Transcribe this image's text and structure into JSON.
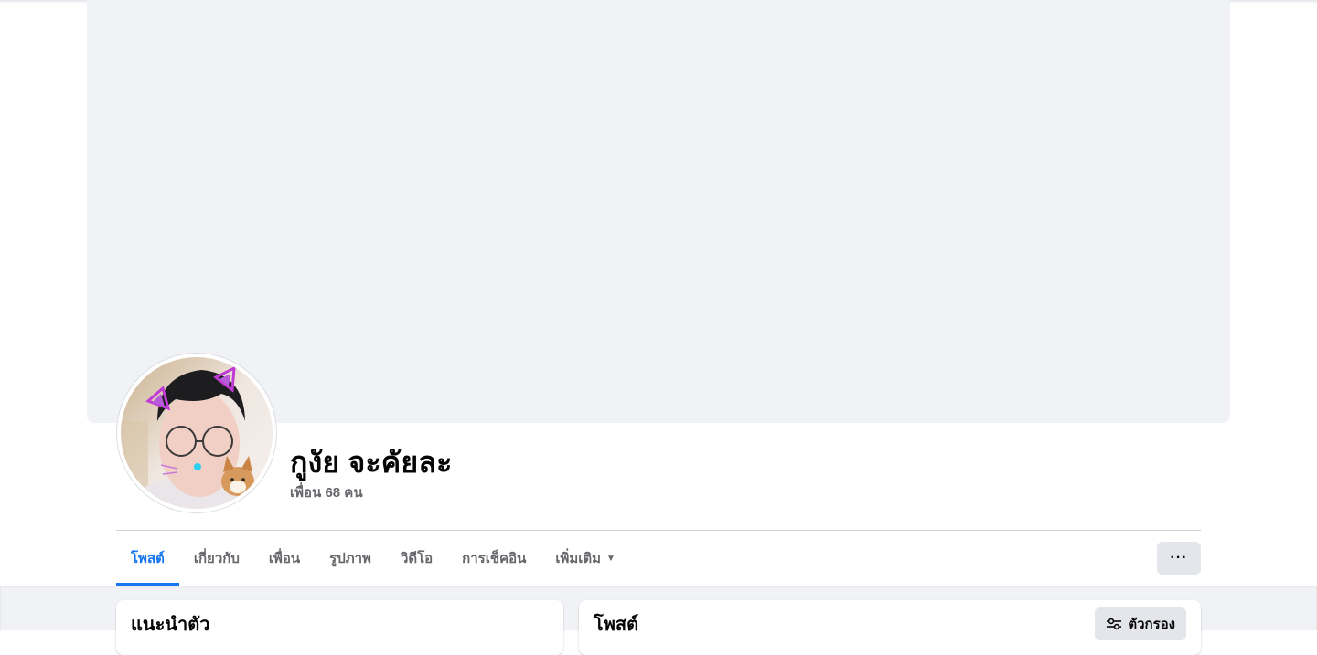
{
  "profile": {
    "name": "กูงัย จะคัยละ",
    "friends_text": "เพื่อน 68 คน"
  },
  "tabs": [
    {
      "label": "โพสต์",
      "active": true
    },
    {
      "label": "เกี่ยวกับ",
      "active": false
    },
    {
      "label": "เพื่อน",
      "active": false
    },
    {
      "label": "รูปภาพ",
      "active": false
    },
    {
      "label": "วิดีโอ",
      "active": false
    },
    {
      "label": "การเช็คอิน",
      "active": false
    },
    {
      "label": "เพิ่มเติม",
      "active": false
    }
  ],
  "more_button": {
    "label": "···",
    "icon": "more-dots-icon"
  },
  "intro_card": {
    "title": "แนะนำตัว"
  },
  "posts_card": {
    "title": "โพสต์",
    "filter_label": "ตัวกรอง",
    "filter_icon": "filter-sliders-icon"
  },
  "colors": {
    "accent": "#1877f2",
    "secondary_text": "#65676b",
    "cover_bg": "#f0f2f5",
    "button_bg": "#e4e6eb"
  }
}
